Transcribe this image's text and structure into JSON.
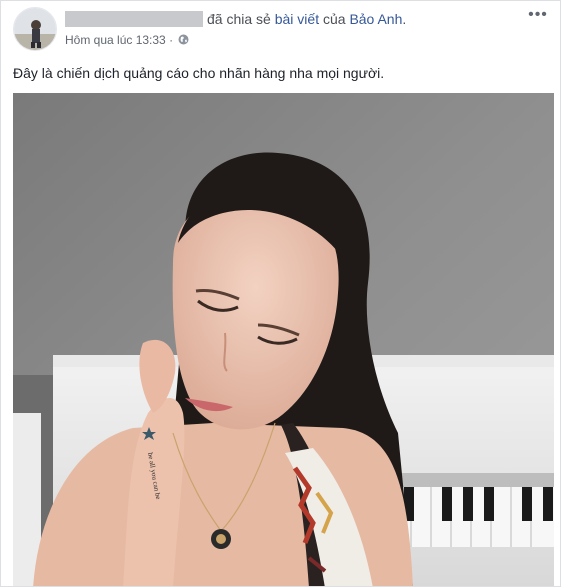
{
  "post": {
    "shared_text": "đã chia sẻ",
    "post_link": "bài viết",
    "of_text": "của",
    "page_name": "Bảo Anh",
    "period": ".",
    "timestamp": "Hôm qua lúc 13:33",
    "separator": "·",
    "audience_icon": "globe-icon",
    "more_label": "•••",
    "message": "Đây là chiến dịch quảng cáo cho nhãn hàng nha mọi người.",
    "tattoo_text": "be all you can be"
  },
  "colors": {
    "link": "#365899",
    "meta": "#616770",
    "text": "#1d2129",
    "redaction": "#c8c9cc"
  }
}
